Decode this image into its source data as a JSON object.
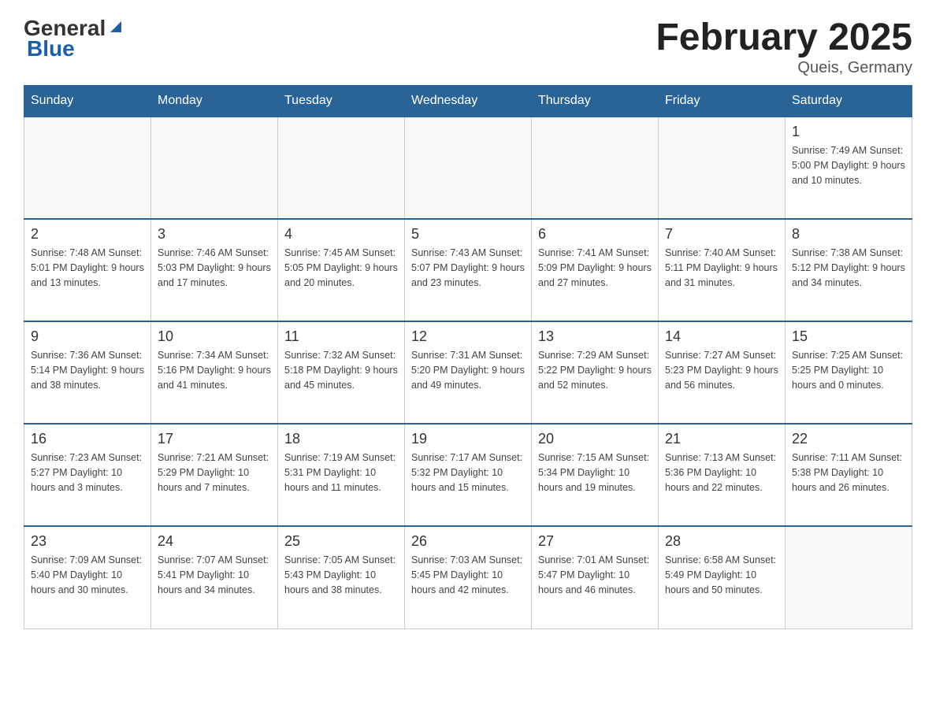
{
  "logo": {
    "general": "General",
    "blue": "Blue"
  },
  "title": "February 2025",
  "subtitle": "Queis, Germany",
  "days_of_week": [
    "Sunday",
    "Monday",
    "Tuesday",
    "Wednesday",
    "Thursday",
    "Friday",
    "Saturday"
  ],
  "weeks": [
    [
      {
        "day": "",
        "info": ""
      },
      {
        "day": "",
        "info": ""
      },
      {
        "day": "",
        "info": ""
      },
      {
        "day": "",
        "info": ""
      },
      {
        "day": "",
        "info": ""
      },
      {
        "day": "",
        "info": ""
      },
      {
        "day": "1",
        "info": "Sunrise: 7:49 AM\nSunset: 5:00 PM\nDaylight: 9 hours\nand 10 minutes."
      }
    ],
    [
      {
        "day": "2",
        "info": "Sunrise: 7:48 AM\nSunset: 5:01 PM\nDaylight: 9 hours\nand 13 minutes."
      },
      {
        "day": "3",
        "info": "Sunrise: 7:46 AM\nSunset: 5:03 PM\nDaylight: 9 hours\nand 17 minutes."
      },
      {
        "day": "4",
        "info": "Sunrise: 7:45 AM\nSunset: 5:05 PM\nDaylight: 9 hours\nand 20 minutes."
      },
      {
        "day": "5",
        "info": "Sunrise: 7:43 AM\nSunset: 5:07 PM\nDaylight: 9 hours\nand 23 minutes."
      },
      {
        "day": "6",
        "info": "Sunrise: 7:41 AM\nSunset: 5:09 PM\nDaylight: 9 hours\nand 27 minutes."
      },
      {
        "day": "7",
        "info": "Sunrise: 7:40 AM\nSunset: 5:11 PM\nDaylight: 9 hours\nand 31 minutes."
      },
      {
        "day": "8",
        "info": "Sunrise: 7:38 AM\nSunset: 5:12 PM\nDaylight: 9 hours\nand 34 minutes."
      }
    ],
    [
      {
        "day": "9",
        "info": "Sunrise: 7:36 AM\nSunset: 5:14 PM\nDaylight: 9 hours\nand 38 minutes."
      },
      {
        "day": "10",
        "info": "Sunrise: 7:34 AM\nSunset: 5:16 PM\nDaylight: 9 hours\nand 41 minutes."
      },
      {
        "day": "11",
        "info": "Sunrise: 7:32 AM\nSunset: 5:18 PM\nDaylight: 9 hours\nand 45 minutes."
      },
      {
        "day": "12",
        "info": "Sunrise: 7:31 AM\nSunset: 5:20 PM\nDaylight: 9 hours\nand 49 minutes."
      },
      {
        "day": "13",
        "info": "Sunrise: 7:29 AM\nSunset: 5:22 PM\nDaylight: 9 hours\nand 52 minutes."
      },
      {
        "day": "14",
        "info": "Sunrise: 7:27 AM\nSunset: 5:23 PM\nDaylight: 9 hours\nand 56 minutes."
      },
      {
        "day": "15",
        "info": "Sunrise: 7:25 AM\nSunset: 5:25 PM\nDaylight: 10 hours\nand 0 minutes."
      }
    ],
    [
      {
        "day": "16",
        "info": "Sunrise: 7:23 AM\nSunset: 5:27 PM\nDaylight: 10 hours\nand 3 minutes."
      },
      {
        "day": "17",
        "info": "Sunrise: 7:21 AM\nSunset: 5:29 PM\nDaylight: 10 hours\nand 7 minutes."
      },
      {
        "day": "18",
        "info": "Sunrise: 7:19 AM\nSunset: 5:31 PM\nDaylight: 10 hours\nand 11 minutes."
      },
      {
        "day": "19",
        "info": "Sunrise: 7:17 AM\nSunset: 5:32 PM\nDaylight: 10 hours\nand 15 minutes."
      },
      {
        "day": "20",
        "info": "Sunrise: 7:15 AM\nSunset: 5:34 PM\nDaylight: 10 hours\nand 19 minutes."
      },
      {
        "day": "21",
        "info": "Sunrise: 7:13 AM\nSunset: 5:36 PM\nDaylight: 10 hours\nand 22 minutes."
      },
      {
        "day": "22",
        "info": "Sunrise: 7:11 AM\nSunset: 5:38 PM\nDaylight: 10 hours\nand 26 minutes."
      }
    ],
    [
      {
        "day": "23",
        "info": "Sunrise: 7:09 AM\nSunset: 5:40 PM\nDaylight: 10 hours\nand 30 minutes."
      },
      {
        "day": "24",
        "info": "Sunrise: 7:07 AM\nSunset: 5:41 PM\nDaylight: 10 hours\nand 34 minutes."
      },
      {
        "day": "25",
        "info": "Sunrise: 7:05 AM\nSunset: 5:43 PM\nDaylight: 10 hours\nand 38 minutes."
      },
      {
        "day": "26",
        "info": "Sunrise: 7:03 AM\nSunset: 5:45 PM\nDaylight: 10 hours\nand 42 minutes."
      },
      {
        "day": "27",
        "info": "Sunrise: 7:01 AM\nSunset: 5:47 PM\nDaylight: 10 hours\nand 46 minutes."
      },
      {
        "day": "28",
        "info": "Sunrise: 6:58 AM\nSunset: 5:49 PM\nDaylight: 10 hours\nand 50 minutes."
      },
      {
        "day": "",
        "info": ""
      }
    ]
  ]
}
